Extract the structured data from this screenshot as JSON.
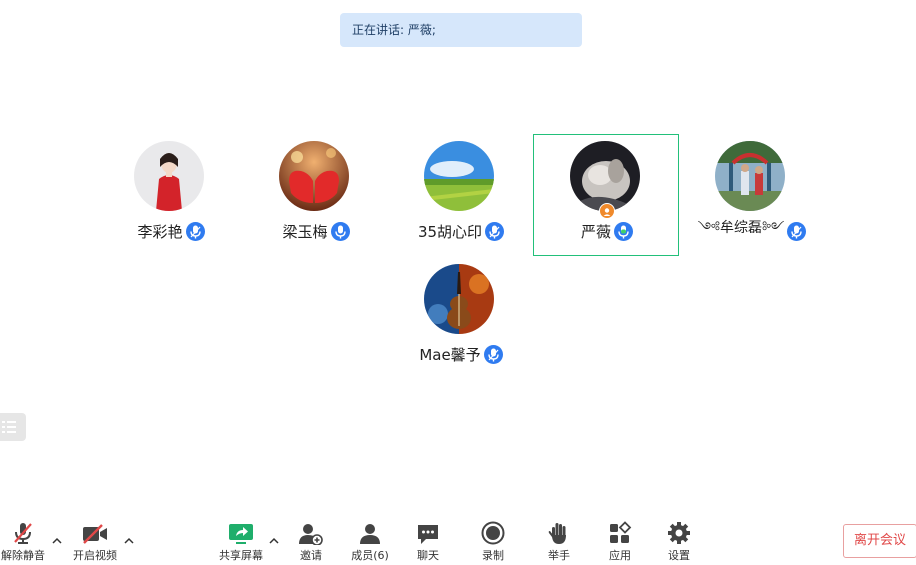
{
  "speaking": {
    "label": "正在讲话: 严薇;"
  },
  "participants": [
    {
      "name": "李彩艳",
      "mic_color": "#2f7bf0"
    },
    {
      "name": "梁玉梅",
      "mic_color": "#2f7bf0"
    },
    {
      "name": "35胡心印",
      "mic_color": "#2f7bf0"
    },
    {
      "name": "严薇",
      "mic_color": "#2f7bf0",
      "speaking": true,
      "host": true
    },
    {
      "name": "༺牟综磊༻",
      "mic_color": "#2f7bf0"
    },
    {
      "name": "Mae馨予",
      "mic_color": "#2f7bf0"
    }
  ],
  "toolbar": {
    "unmute": "解除静音",
    "video": "开启视频",
    "share": "共享屏幕",
    "invite": "邀请",
    "members": "成员(6)",
    "chat": "聊天",
    "record": "录制",
    "raise_hand": "举手",
    "apps": "应用",
    "settings": "设置",
    "leave": "离开会议"
  },
  "colors": {
    "accent": "#2f7bf0",
    "active_border": "#22c07a",
    "share_green": "#1fae6b",
    "leave_red": "#e04848"
  }
}
